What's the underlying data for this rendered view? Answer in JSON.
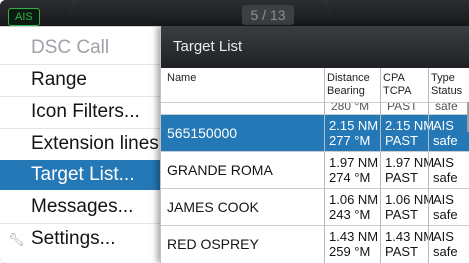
{
  "topbar": {
    "ais_badge": "AIS",
    "page_counter": "5 / 13"
  },
  "menu": {
    "items": [
      {
        "label": "DSC Call",
        "state": "disabled"
      },
      {
        "label": "Range",
        "state": "normal"
      },
      {
        "label": "Icon Filters...",
        "state": "normal"
      },
      {
        "label": "Extension lines...",
        "state": "normal"
      },
      {
        "label": "Target List...",
        "state": "selected"
      },
      {
        "label": "Messages...",
        "state": "normal"
      },
      {
        "label": "Settings...",
        "state": "normal",
        "icon": "wrench-icon"
      }
    ]
  },
  "target_list": {
    "title": "Target List",
    "columns": [
      {
        "line1": "Name",
        "line2": ""
      },
      {
        "line1": "Distance",
        "line2": "Bearing"
      },
      {
        "line1": "CPA",
        "line2": "TCPA"
      },
      {
        "line1": "Type",
        "line2": "Status"
      }
    ],
    "partial_row": {
      "bearing": "280 °M",
      "tcpa": "PAST",
      "status": "safe"
    },
    "rows": [
      {
        "name": "565150000",
        "distance": "2.15 NM",
        "bearing": "277 °M",
        "cpa": "2.15 NM",
        "tcpa": "PAST",
        "type": "AIS",
        "status": "safe",
        "selected": true
      },
      {
        "name": "GRANDE ROMA",
        "distance": "1.97 NM",
        "bearing": "274 °M",
        "cpa": "1.97 NM",
        "tcpa": "PAST",
        "type": "AIS",
        "status": "safe",
        "selected": false
      },
      {
        "name": "JAMES COOK",
        "distance": "1.06 NM",
        "bearing": "243 °M",
        "cpa": "1.06 NM",
        "tcpa": "PAST",
        "type": "AIS",
        "status": "safe",
        "selected": false
      },
      {
        "name": "RED OSPREY",
        "distance": "1.43 NM",
        "bearing": "259 °M",
        "cpa": "1.43 NM",
        "tcpa": "PAST",
        "type": "AIS",
        "status": "safe",
        "selected": false
      }
    ]
  },
  "colors": {
    "selection": "#2478b5",
    "ais_green": "#2fb24a",
    "header_dark": "#1f2124"
  }
}
